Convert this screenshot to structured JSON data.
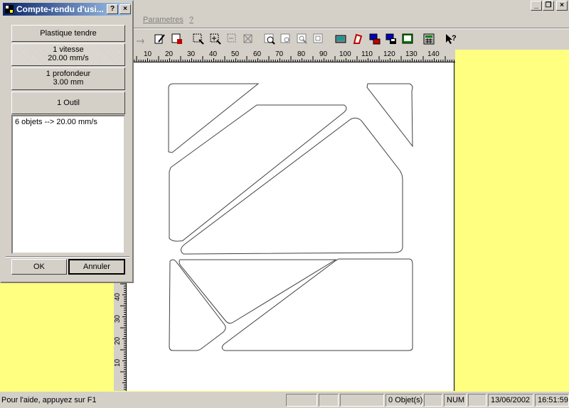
{
  "menubar": {
    "items": [
      "Parametres",
      "?"
    ]
  },
  "dialog": {
    "title": "Compte-rendu d'usi...",
    "help_btn": "?",
    "close_btn": "×",
    "material_label": "Plastique tendre",
    "speed_line1": "1 vitesse",
    "speed_line2": "20.00 mm/s",
    "depth_line1": "1 profondeur",
    "depth_line2": "3.00 mm",
    "tool_label": "1 Outil",
    "list_items": [
      "6 objets --> 20.00 mm/s"
    ],
    "ok_label": "OK",
    "cancel_label": "Annuler"
  },
  "ruler": {
    "h_ticks": [
      "10",
      "20",
      "30",
      "40",
      "50",
      "60",
      "70",
      "80",
      "90",
      "100",
      "110",
      "120",
      "130",
      "140"
    ],
    "v_ticks": [
      "40",
      "30",
      "20",
      "10"
    ]
  },
  "statusbar": {
    "help_text": "Pour l'aide, appuyez sur F1",
    "objects": "0 Objet(s)",
    "num": "NUM",
    "date": "13/06/2002",
    "time": "16:51:59"
  },
  "colors": {
    "workspace": "#ffff80",
    "titlebar": "#0a246a",
    "chrome": "#d4d0c8"
  }
}
